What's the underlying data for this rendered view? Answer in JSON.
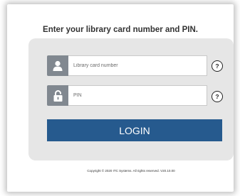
{
  "heading": "Enter your library card number and PIN.",
  "username": {
    "placeholder": "Library card number",
    "icon": "user-icon",
    "help_label": "?"
  },
  "pin": {
    "placeholder": "PIN",
    "icon": "lock-icon",
    "help_label": "?"
  },
  "login_label": "LOGIN",
  "footer": "Copyright © 2020 ITC Systems. All rights reserved. V20.10.00",
  "colors": {
    "accent": "#265a8e",
    "icon_bg": "#818890",
    "panel_bg": "#e6e6e6"
  }
}
